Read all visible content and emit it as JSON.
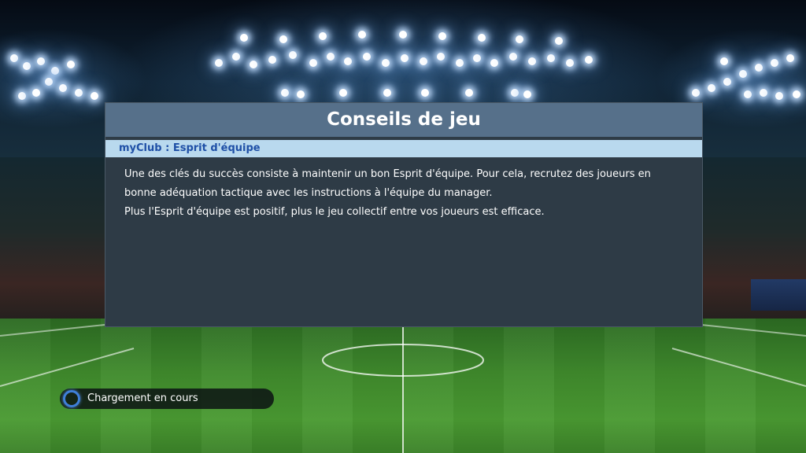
{
  "dialog": {
    "title": "Conseils de jeu",
    "subtitle": "myClub : Esprit d'équipe",
    "paragraphs": [
      "Une des clés du succès consiste à maintenir un bon Esprit d'équipe. Pour cela, recrutez des joueurs en bonne adéquation tactique avec les instructions à l'équipe du manager.",
      "Plus l'Esprit d'équipe est positif, plus le jeu collectif entre vos joueurs est efficace."
    ]
  },
  "loading": {
    "label": "Chargement en cours",
    "icon": "loading-spinner-icon"
  },
  "colors": {
    "header_bg": "#56708a",
    "subtitle_bg": "#b9d9ee",
    "subtitle_text": "#1e4fa6",
    "panel_bg": "#2e3b46",
    "spinner": "#3f7fd8"
  }
}
